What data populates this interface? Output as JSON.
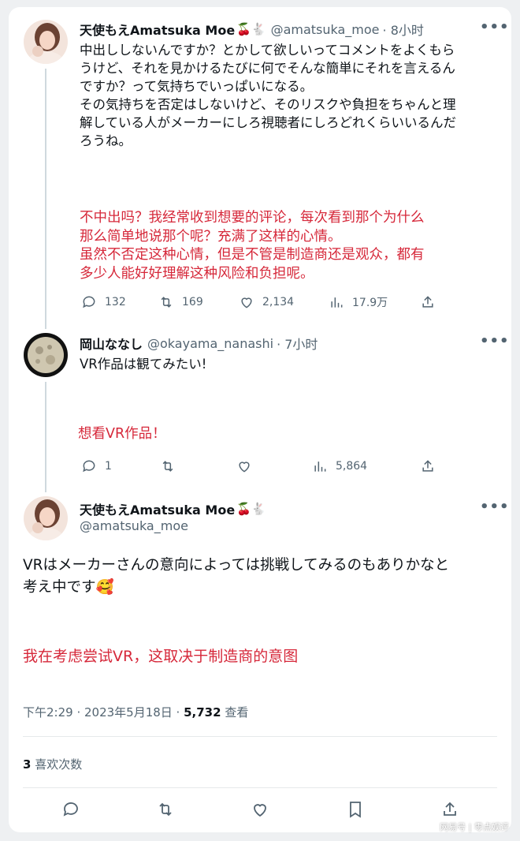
{
  "tweet1": {
    "name": "天使もえAmatsuka Moe",
    "emojis": "🍒🐇",
    "handle": "@amatsuka_moe",
    "time": "· 8小时",
    "text": "中出ししないんですか？とかして欲しいってコメントをよくもら\nうけど、それを見かけるたびに何でそんな簡単にそれを言えるん\nですか？って気持ちでいっぱいになる。\nその気持ちを否定はしないけど、そのリスクや負担をちゃんと理\n解している人がメーカーにしろ視聴者にしろどれくらいいるんだ\nろうね。",
    "translation": "不中出吗？我经常收到想要的评论，每次看到那个为什么\n那么简单地说那个呢？充满了这样的心情。\n虽然不否定这种心情，但是不管是制造商还是观众，都有\n多少人能好好理解这种风险和负担呢。",
    "replies": "132",
    "retweets": "169",
    "likes": "2,134",
    "views": "17.9万"
  },
  "tweet2": {
    "name": "岡山ななし",
    "handle": "@okayama_nanashi",
    "time": "· 7小时",
    "text": "VR作品は観てみたい!",
    "translation": "想看VR作品！",
    "replies": "1",
    "views": "5,864"
  },
  "tweet3": {
    "name": "天使もえAmatsuka Moe",
    "emojis": "🍒🐇",
    "handle": "@amatsuka_moe",
    "text": "VRはメーカーさんの意向によっては挑戦してみるのもありかなと\n考え中です🥰",
    "translation": "我在考虑尝试VR，这取决于制造商的意图",
    "timestamp": "下午2:29 · 2023年5月18日 · ",
    "view_count": "5,732",
    "view_label": " 查看",
    "likes_count": "3",
    "likes_label": " 喜欢次数"
  },
  "more_glyph": "•••",
  "watermark": "网易号 | 零点娱评",
  "colors": {
    "translation_red": "#d6283a",
    "secondary_gray": "#536471"
  }
}
